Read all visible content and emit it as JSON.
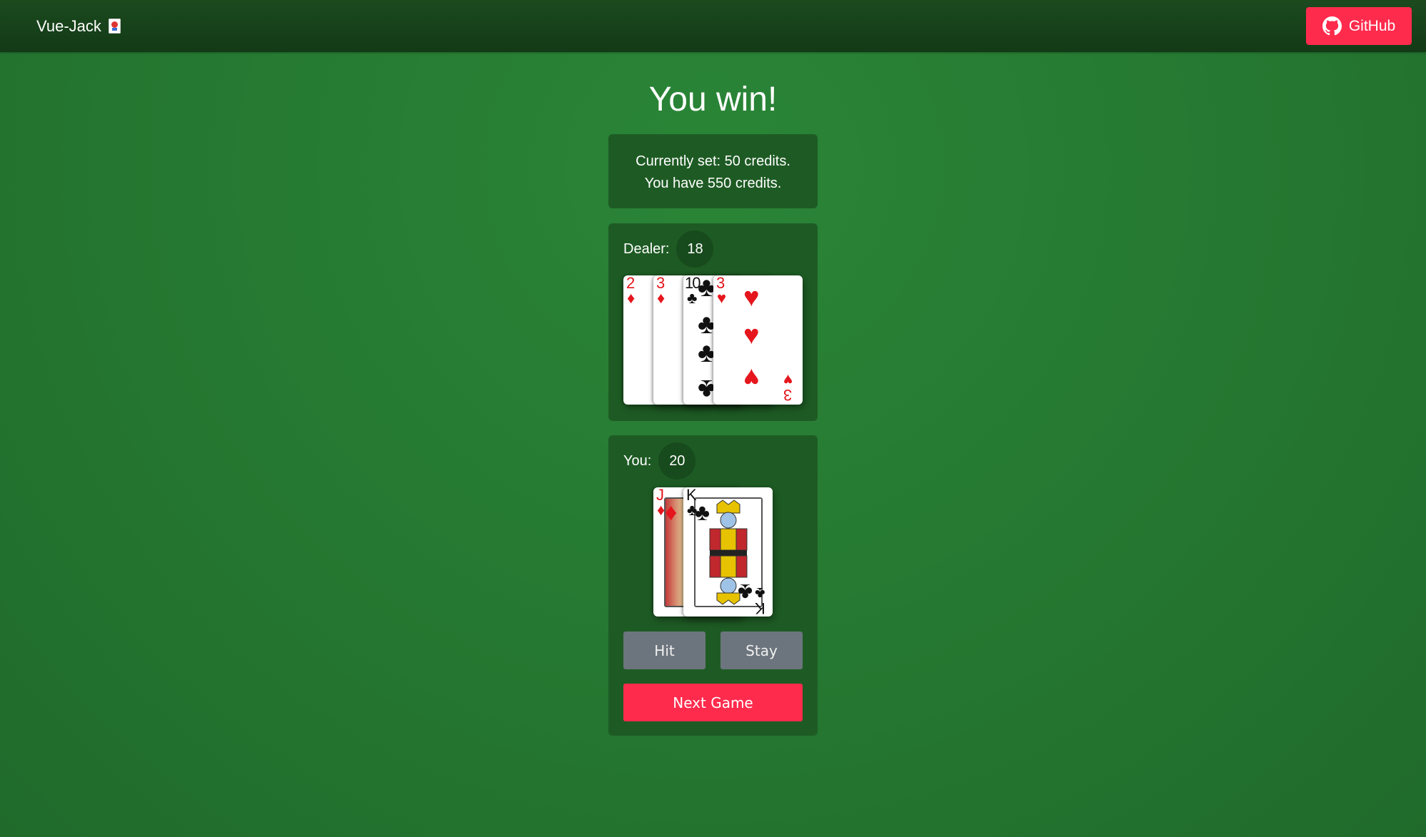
{
  "navbar": {
    "brand": "Vue-Jack",
    "brand_icon": "joker-card-icon",
    "github_label": "GitHub",
    "github_icon": "github-icon",
    "github_color": "#ff2b4d"
  },
  "result_title": "You win!",
  "credits": {
    "line1": "Currently set: 50 credits.",
    "line2": "You have 550 credits."
  },
  "dealer": {
    "label": "Dealer:",
    "score": "18",
    "cards": [
      {
        "rank": "2",
        "suit": "♦",
        "color": "red"
      },
      {
        "rank": "3",
        "suit": "♦",
        "color": "red"
      },
      {
        "rank": "10",
        "suit": "♣",
        "color": "black"
      },
      {
        "rank": "3",
        "suit": "♥",
        "color": "red"
      }
    ]
  },
  "player": {
    "label": "You:",
    "score": "20",
    "cards": [
      {
        "rank": "J",
        "suit": "♦",
        "color": "red"
      },
      {
        "rank": "K",
        "suit": "♣",
        "color": "black"
      }
    ]
  },
  "actions": {
    "hit": "Hit",
    "stay": "Stay",
    "next_game": "Next Game"
  },
  "colors": {
    "table_green": "#267a32",
    "panel_green": "#1e5b24",
    "accent_red": "#ff2b4d",
    "button_gray": "#6c757d"
  }
}
